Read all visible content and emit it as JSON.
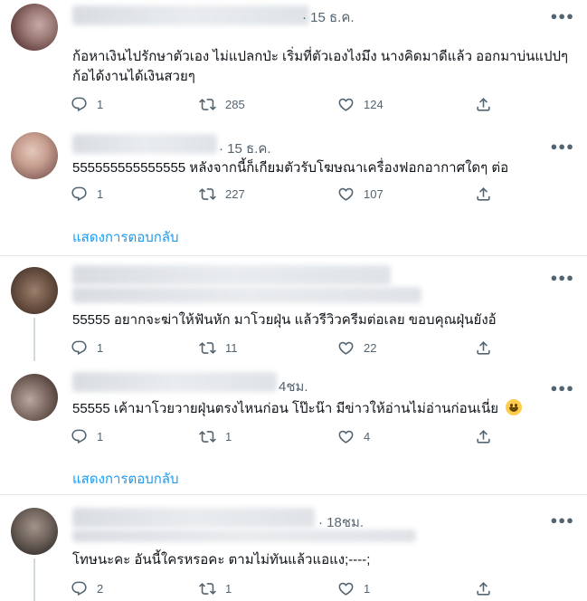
{
  "tweets": [
    {
      "time": "15 ธ.ค.",
      "text": "ก้อหาเงินไปรักษาตัวเอง ไม่แปลกป่ะ เริ่มที่ตัวเองไงมึง นางคิดมาดีแล้ว ออกมาบ่นแปปๆก้อได้งานได้เงินสวยๆ",
      "replies": "1",
      "retweets": "285",
      "likes": "124"
    },
    {
      "time": "15 ธ.ค.",
      "text": "555555555555555 หลังจากนี้ก็เกียมตัวรับโฆษณาเครื่องฟอกอากาศใดๆ ต่อ",
      "replies": "1",
      "retweets": "227",
      "likes": "107",
      "show_replies": "แสดงการตอบกลับ"
    },
    {
      "time": "",
      "text": "55555 อยากจะฆ่าให้ฟันหัก มาโวยฝุ่น แล้วรีวิวครีมต่อเลย ขอบคุณฝุ่นยังอ้",
      "replies": "1",
      "retweets": "11",
      "likes": "22"
    },
    {
      "time": "4ชม.",
      "text": "55555 เค้ามาโวยวายฝุ่นตรงไหนก่อน โป๊ะน๊า มีข่าวให้อ่านไม่อ่านก่อนเนี่ย",
      "replies": "1",
      "retweets": "1",
      "likes": "4",
      "show_replies": "แสดงการตอบกลับ"
    },
    {
      "time": "18ชม.",
      "text": "โทษนะคะ อันนี้ใครหรอคะ ตามไม่ทันแล้วแอแง;----;",
      "replies": "2",
      "retweets": "1",
      "likes": "1"
    }
  ],
  "more_label": "○○○",
  "icons": {
    "reply": "reply-icon",
    "retweet": "retweet-icon",
    "like": "heart-icon",
    "share": "share-icon",
    "emoji": "grinning-face-emoji"
  },
  "colors": {
    "text": "#0f1419",
    "secondary": "#536471",
    "link": "#1d9bf0",
    "divider": "#eff3f4"
  }
}
